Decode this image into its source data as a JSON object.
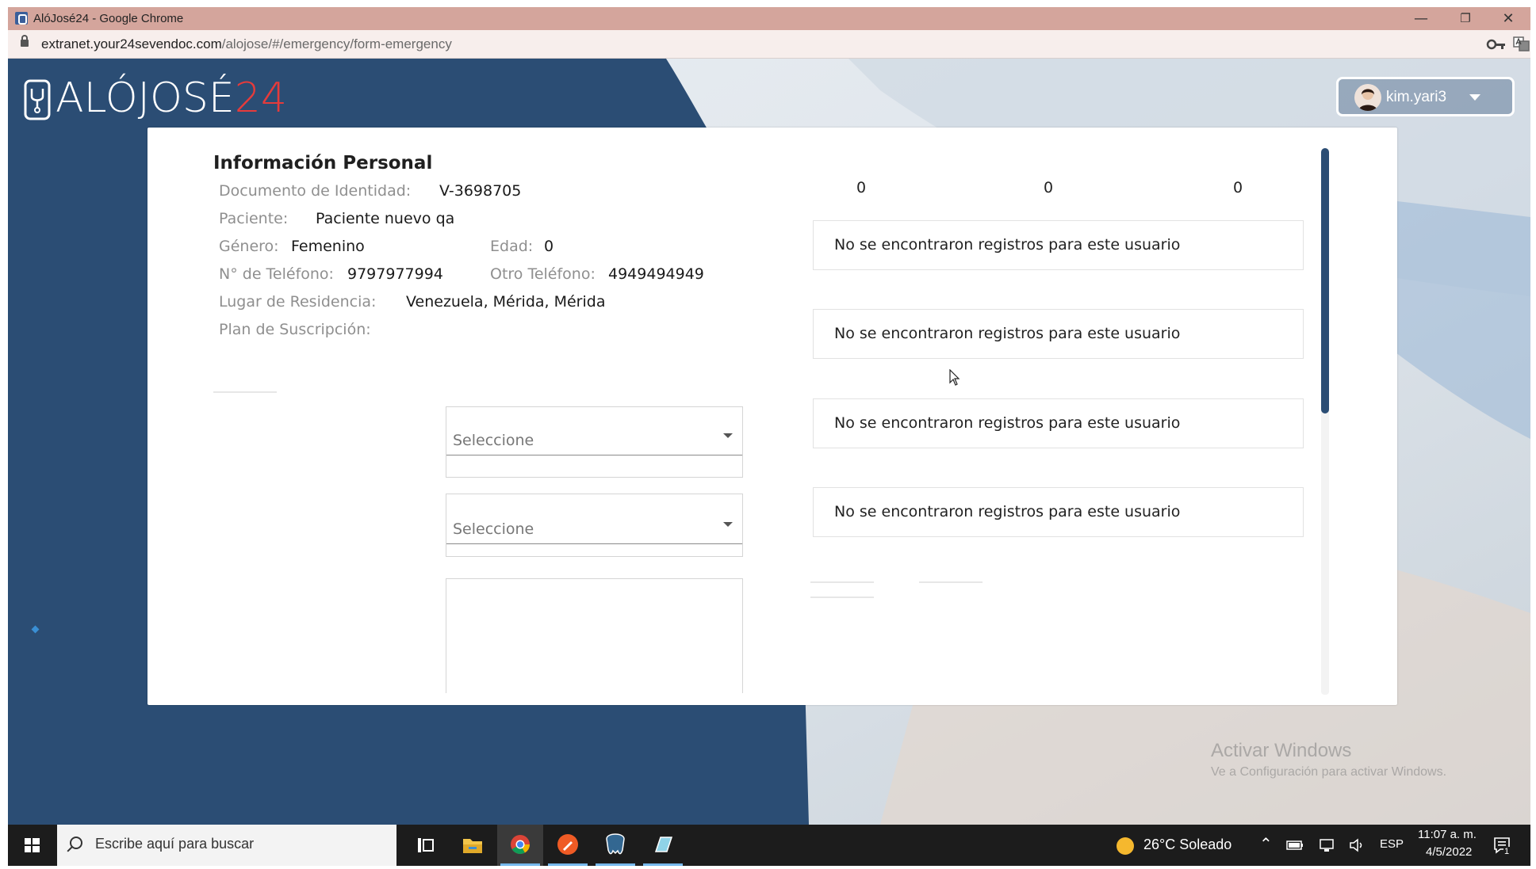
{
  "browser": {
    "title": "AlóJosé24 - Google Chrome",
    "url_host": "extranet.your24sevendoc.com",
    "url_path": "/alojose/#/emergency/form-emergency",
    "controls": {
      "minimize": "—",
      "maximize": "❐",
      "close": "✕"
    }
  },
  "header": {
    "logo_text": "ALÓJOSÉ",
    "logo_number": "24",
    "user_name": "kim.yari3"
  },
  "personal_info": {
    "title": "Información Personal",
    "document_label": "Documento de Identidad:",
    "document_value": "V-3698705",
    "patient_label": "Paciente:",
    "patient_value": "Paciente nuevo qa",
    "gender_label": "Género:",
    "gender_value": "Femenino",
    "age_label": "Edad:",
    "age_value": "0",
    "phone_label": "N° de Teléfono:",
    "phone_value": "9797977994",
    "other_phone_label": "Otro Teléfono:",
    "other_phone_value": "4949494949",
    "residence_label": "Lugar de Residencia:",
    "residence_value": "Venezuela, Mérida, Mérida",
    "plan_label": "Plan de Suscripción:",
    "plan_value": ""
  },
  "counters": [
    "0",
    "0",
    "0"
  ],
  "records": [
    "No se encontraron registros para este usuario",
    "No se encontraron registros para este usuario",
    "No se encontraron registros para este usuario",
    "No se encontraron registros para este usuario"
  ],
  "selects": [
    {
      "placeholder": "Seleccione"
    },
    {
      "placeholder": "Seleccione"
    }
  ],
  "watermark": {
    "line1": "Activar Windows",
    "line2": "Ve a Configuración para activar Windows."
  },
  "taskbar": {
    "search_placeholder": "Escribe aquí para buscar",
    "weather": "26°C  Soleado",
    "language": "ESP",
    "time": "11:07 a. m.",
    "date": "4/5/2022",
    "notification_count": "1"
  },
  "colors": {
    "brand_blue": "#2b4d74",
    "logo_red": "#e63b3b",
    "title_bar": "#d4a59c"
  }
}
